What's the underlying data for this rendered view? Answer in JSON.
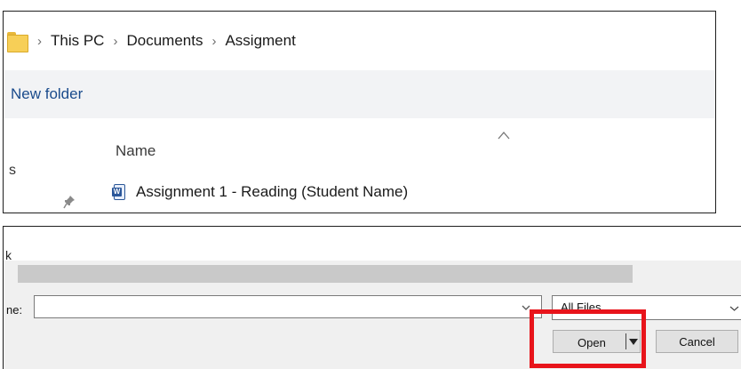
{
  "explorer": {
    "breadcrumbs": [
      "This PC",
      "Documents",
      "Assigment"
    ],
    "toolbar": {
      "new_folder": "New folder"
    },
    "nav_partial_text": "s",
    "column_header": "Name",
    "files": [
      {
        "name": "Assignment 1 - Reading (Student Name)",
        "icon": "word-document-icon"
      }
    ]
  },
  "dialog": {
    "partial_label": "k",
    "file_name_label": "ne:",
    "file_name_value": "",
    "file_type_filter": "All Files",
    "open_button": "Open",
    "cancel_button": "Cancel"
  },
  "colors": {
    "highlight": "#e8141b",
    "folder": "#f7cf57",
    "word_blue": "#2b579a",
    "toolbar_bg": "#f2f3f5",
    "dialog_bg": "#f0f0f0"
  }
}
